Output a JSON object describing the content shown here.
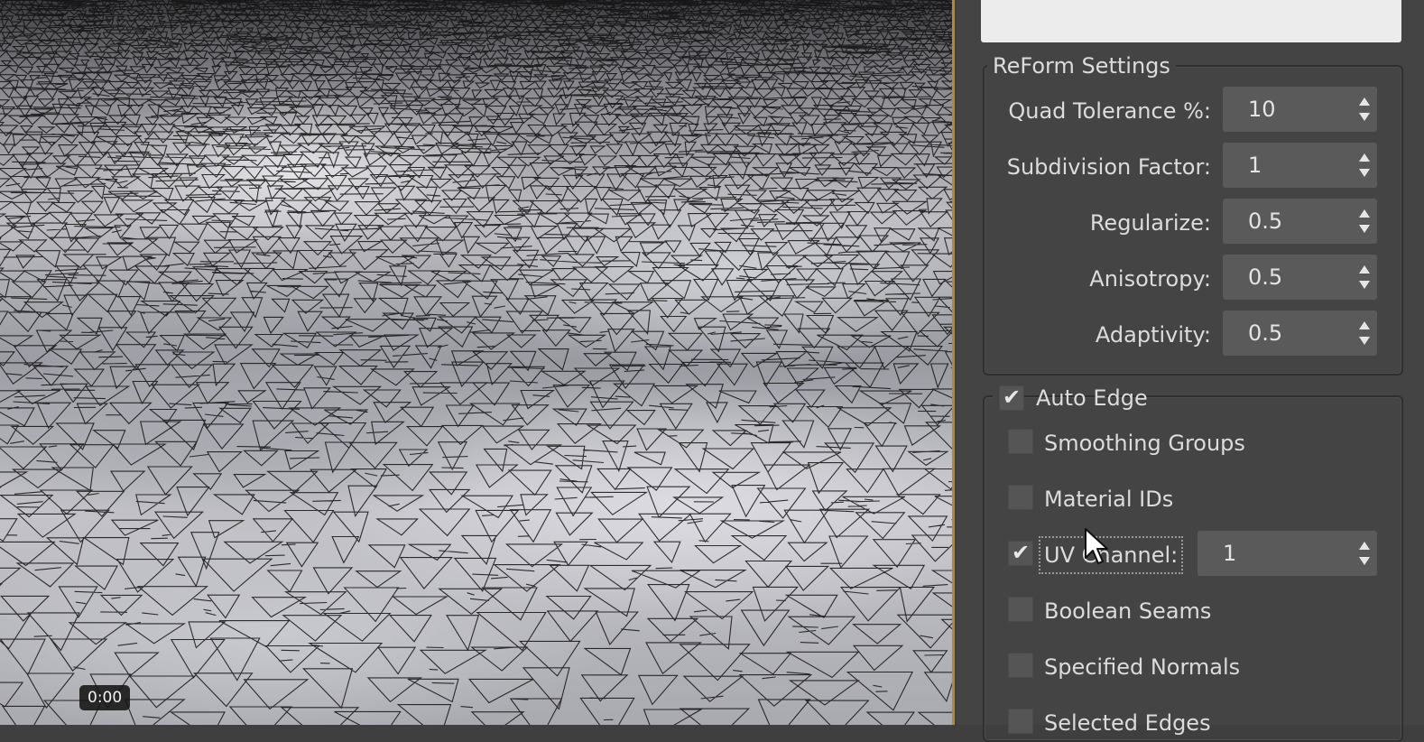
{
  "viewport": {
    "timecode": "0:00"
  },
  "reform_settings": {
    "title": "ReForm Settings",
    "rows": [
      {
        "label": "Quad Tolerance %:",
        "value": "10"
      },
      {
        "label": "Subdivision Factor:",
        "value": "1"
      },
      {
        "label": "Regularize:",
        "value": "0.5"
      },
      {
        "label": "Anisotropy:",
        "value": "0.5"
      },
      {
        "label": "Adaptivity:",
        "value": "0.5"
      }
    ]
  },
  "auto_edge": {
    "label": "Auto Edge",
    "checked": true,
    "options": [
      {
        "label": "Smoothing Groups",
        "checked": false
      },
      {
        "label": "Material IDs",
        "checked": false
      },
      {
        "label": "UV Channel:",
        "checked": true,
        "value": "1"
      },
      {
        "label": "Boolean Seams",
        "checked": false
      },
      {
        "label": "Specified Normals",
        "checked": false
      },
      {
        "label": "Selected Edges",
        "checked": false
      }
    ]
  },
  "colors": {
    "panel_bg": "#444444",
    "field_bg": "#5a5a5a",
    "viewport_active_border": "#b58a2a"
  },
  "icons": [
    "spinner-up-icon",
    "spinner-down-icon",
    "checkmark-icon",
    "mouse-cursor-icon"
  ]
}
